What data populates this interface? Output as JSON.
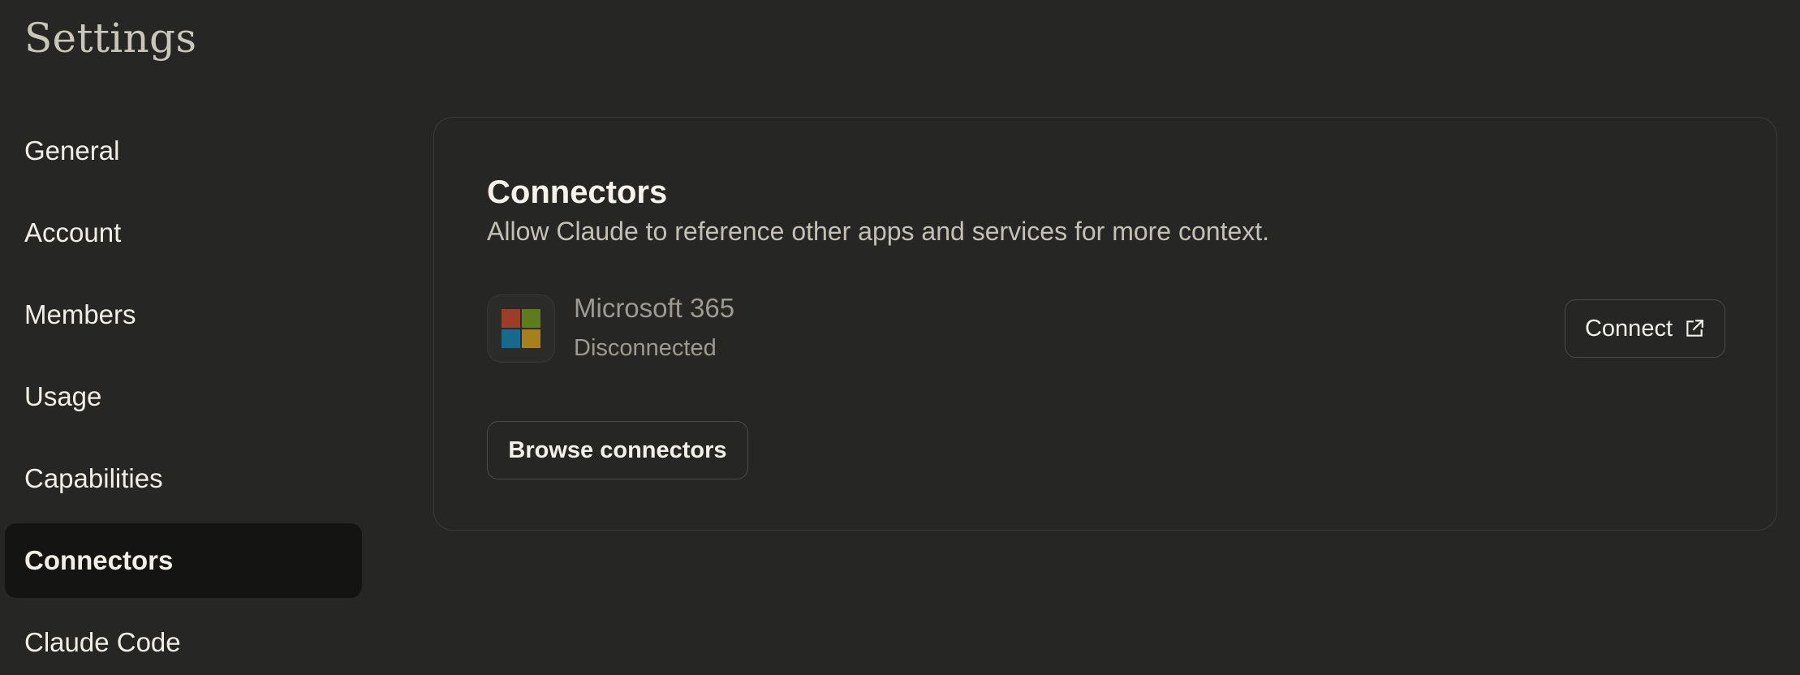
{
  "page": {
    "title": "Settings"
  },
  "sidebar": {
    "items": [
      {
        "label": "General",
        "active": false
      },
      {
        "label": "Account",
        "active": false
      },
      {
        "label": "Members",
        "active": false
      },
      {
        "label": "Usage",
        "active": false
      },
      {
        "label": "Capabilities",
        "active": false
      },
      {
        "label": "Connectors",
        "active": true
      },
      {
        "label": "Claude Code",
        "active": false
      }
    ]
  },
  "connectors": {
    "title": "Connectors",
    "subtitle": "Allow Claude to reference other apps and services for more context.",
    "items": [
      {
        "name": "Microsoft 365",
        "status": "Disconnected",
        "icon": "microsoft-logo-icon",
        "action_label": "Connect",
        "action_icon": "external-link-icon"
      }
    ],
    "browse_label": "Browse connectors"
  },
  "colors": {
    "background": "#262624",
    "active_item_bg": "#141413",
    "card_border": "#3d3c38",
    "ms_red": "#9b3d27",
    "ms_green": "#5f7c1d",
    "ms_blue": "#16698f",
    "ms_yellow": "#a7801a"
  }
}
